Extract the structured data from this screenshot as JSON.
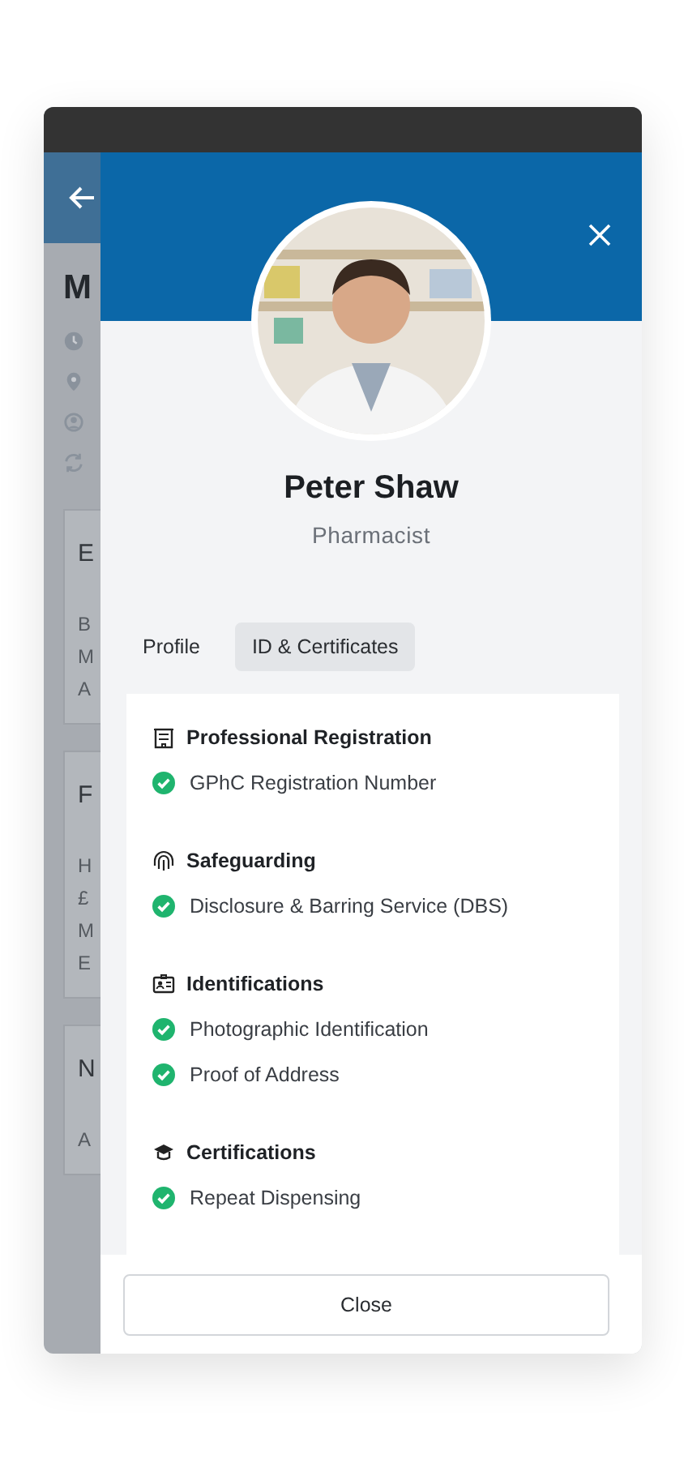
{
  "background_page": {
    "title": "M",
    "cards": [
      {
        "heading": "E",
        "lines": [
          "B",
          "M",
          "A"
        ]
      },
      {
        "heading": "F",
        "lines": [
          "H",
          "£",
          "M",
          "E"
        ]
      },
      {
        "heading": "N",
        "lines": [
          "A"
        ]
      }
    ]
  },
  "modal": {
    "name": "Peter Shaw",
    "role": "Pharmacist",
    "tabs": [
      {
        "label": "Profile",
        "selected": false
      },
      {
        "label": "ID & Certificates",
        "selected": true
      }
    ],
    "sections": [
      {
        "title": "Professional Registration",
        "kind": "building",
        "items": [
          {
            "label": "GPhC Registration Number",
            "verified": true
          }
        ]
      },
      {
        "title": "Safeguarding",
        "kind": "fingerprint",
        "items": [
          {
            "label": "Disclosure & Barring Service (DBS)",
            "verified": true
          }
        ]
      },
      {
        "title": "Identifications",
        "kind": "idcard",
        "items": [
          {
            "label": "Photographic Identification",
            "verified": true
          },
          {
            "label": "Proof of Address",
            "verified": true
          }
        ]
      },
      {
        "title": "Certifications",
        "kind": "cap",
        "items": [
          {
            "label": "Repeat Dispensing",
            "verified": true
          }
        ]
      }
    ],
    "close_button": "Close"
  }
}
